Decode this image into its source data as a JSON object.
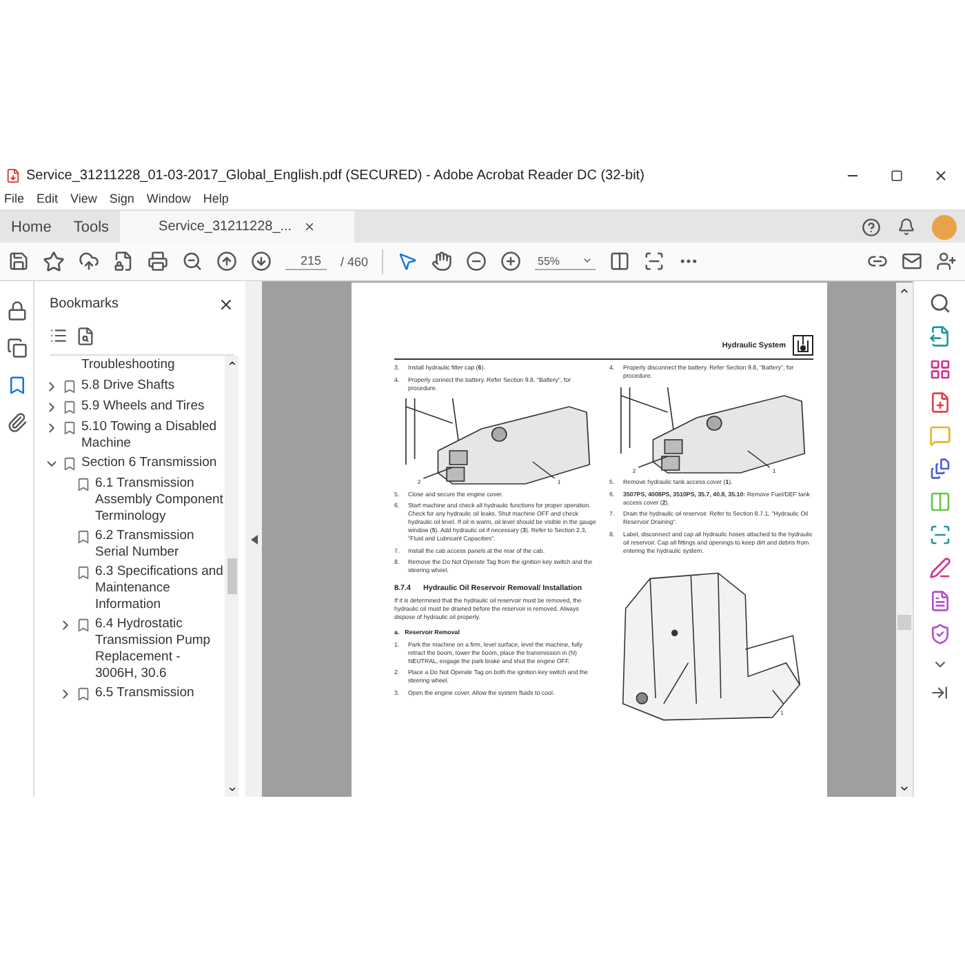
{
  "window": {
    "title": "Service_31211228_01-03-2017_Global_English.pdf (SECURED) - Adobe Acrobat Reader DC (32-bit)"
  },
  "menu": [
    "File",
    "Edit",
    "View",
    "Sign",
    "Window",
    "Help"
  ],
  "tabs": [
    {
      "label": "Home",
      "selected": false,
      "closable": false
    },
    {
      "label": "Tools",
      "selected": false,
      "closable": false
    },
    {
      "label": "Service_31211228_...",
      "selected": true,
      "closable": true
    }
  ],
  "toolbar": {
    "page": "215",
    "page_count": "/ 460",
    "zoom": "55%"
  },
  "left_rail": [
    {
      "kind": "lock",
      "selected": false
    },
    {
      "kind": "pages",
      "selected": false
    },
    {
      "kind": "bookmarks",
      "selected": true
    },
    {
      "kind": "attachments",
      "selected": false
    }
  ],
  "bookmarks": {
    "title": "Bookmarks",
    "items": [
      {
        "label": "Troubleshooting",
        "kind": "continued"
      },
      {
        "label": "5.8 Drive Shafts",
        "kind": "node",
        "expanded": false
      },
      {
        "label": "5.9 Wheels and Tires",
        "kind": "node",
        "expanded": false
      },
      {
        "label": "5.10 Towing a Disabled Machine",
        "kind": "node",
        "expanded": false
      },
      {
        "label": "Section 6 Transmission",
        "kind": "node",
        "expanded": true,
        "children": [
          {
            "label": "6.1 Transmission Assembly Component Terminology",
            "kind": "leaf"
          },
          {
            "label": "6.2 Transmission Serial Number",
            "kind": "leaf"
          },
          {
            "label": "6.3 Specifications and Maintenance Information",
            "kind": "leaf"
          },
          {
            "label": "6.4 Hydrostatic Transmission Pump Replacement - 3006H, 30.6",
            "kind": "node",
            "expanded": false
          },
          {
            "label": "6.5 Transmission",
            "kind": "node",
            "expanded": false
          }
        ]
      }
    ]
  },
  "document": {
    "header": "Hydraulic System",
    "columns": [
      [
        {
          "kind": "step",
          "num": "3.",
          "text": "Install hydraulic filter cap (**6**)."
        },
        {
          "kind": "step",
          "num": "4.",
          "text": "Properly connect the battery. Refer Section 9.8, \"Battery\", for procedure."
        },
        {
          "kind": "figure",
          "callouts": [
            "2",
            "1"
          ]
        },
        {
          "kind": "step",
          "num": "5.",
          "text": "Close and secure the engine cover."
        },
        {
          "kind": "step",
          "num": "6.",
          "text": "Start machine and check all hydraulic functions for proper operation. Check for any hydraulic oil leaks. Shut machine OFF and check hydraulic oil level. If oil is warm, oil level should be visible in the gauge window (**5**). Add hydraulic oil if necessary (**3**). Refer to Section 2.3, \"Fluid and Lubricant Capacities\"."
        },
        {
          "kind": "step",
          "num": "7.",
          "text": "Install the cab access panels at the rear of the cab."
        },
        {
          "kind": "step",
          "num": "8.",
          "text": "Remove the Do Not Operate Tag from the ignition key switch and the steering wheel."
        },
        {
          "kind": "heading",
          "num": "8.7.4",
          "text": "Hydraulic Oil Reservoir Removal/ Installation"
        },
        {
          "kind": "para",
          "text": "If it is determined that the hydraulic oil reservoir must be removed, the hydraulic oil must be drained before the reservoir is removed. Always dispose of hydraulic oil properly."
        },
        {
          "kind": "subheading",
          "num": "a.",
          "text": "Reservoir Removal"
        },
        {
          "kind": "step",
          "num": "1.",
          "text": "Park the machine on a firm, level surface, level the machine, fully retract the boom, lower the boom, place the transmission in (N) NEUTRAL, engage the park brake and shut the engine OFF."
        },
        {
          "kind": "step",
          "num": "2.",
          "text": "Place a Do Not Operate Tag on both the ignition key switch and the steering wheel."
        },
        {
          "kind": "step",
          "num": "3.",
          "text": "Open the engine cover. Allow the system fluids to cool."
        }
      ],
      [
        {
          "kind": "step",
          "num": "4.",
          "text": "Properly disconnect the battery. Refer Section 9.8, \"Battery\", for procedure."
        },
        {
          "kind": "figure",
          "callouts": [
            "2",
            "1"
          ]
        },
        {
          "kind": "step",
          "num": "5.",
          "text": "Remove hydraulic tank access cover (**1**)."
        },
        {
          "kind": "step",
          "num": "6.",
          "text": "**3507PS, 4008PS, 3510PS, 35.7, 40.8, 35.10:** Remove Fuel/DEF tank access cover (**2**)."
        },
        {
          "kind": "step",
          "num": "7.",
          "text": "Drain the hydraulic oil reservoir. Refer to Section 8.7.1, \"Hydraulic Oil Reservoir Draining\"."
        },
        {
          "kind": "step",
          "num": "8.",
          "text": "Label, disconnect and cap all hydraulic hoses attached to the hydraulic oil reservoir. Cap all fittings and openings to keep dirt and debris from entering the hydraulic system."
        },
        {
          "kind": "cab",
          "callouts": [
            "1"
          ]
        }
      ]
    ]
  },
  "tools_rail": [
    {
      "kind": "search",
      "color": "#555555"
    },
    {
      "kind": "export",
      "color": "#1b9aa0"
    },
    {
      "kind": "organize",
      "color": "#d0338a"
    },
    {
      "kind": "create",
      "color": "#e0424a"
    },
    {
      "kind": "comment",
      "color": "#e8b51c"
    },
    {
      "kind": "combine",
      "color": "#4a5fd6"
    },
    {
      "kind": "compare",
      "color": "#6cc24a"
    },
    {
      "kind": "scan",
      "color": "#1b9aa0"
    },
    {
      "kind": "sign",
      "color": "#d0338a"
    },
    {
      "kind": "form",
      "color": "#b44fd0"
    },
    {
      "kind": "protect",
      "color": "#b44fd0"
    }
  ]
}
